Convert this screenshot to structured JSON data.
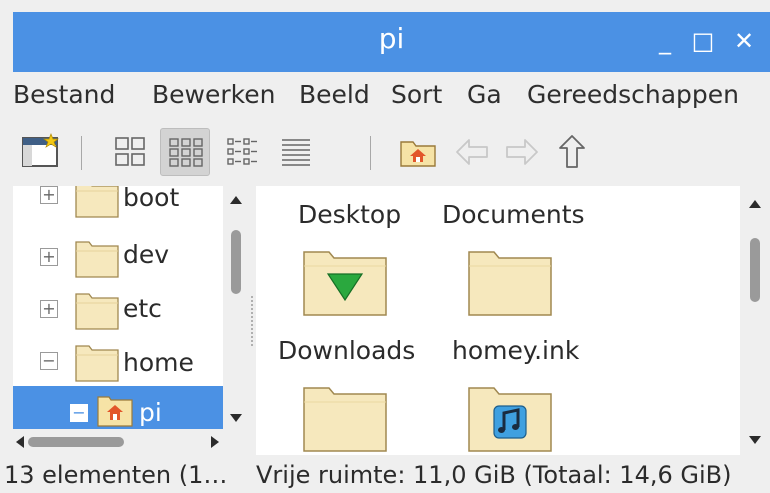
{
  "window": {
    "title": "pi",
    "minimize_glyph": "_",
    "maximize_glyph": "□",
    "close_glyph": "✕",
    "accent_color": "#4b91e4"
  },
  "menubar": {
    "items": [
      "Bestand",
      "Bewerken",
      "Beeld",
      "Sort",
      "Ga",
      "Gereedschappen"
    ]
  },
  "toolbar": {
    "buttons": [
      "new-window-icon",
      "icon-view-icon",
      "thumbnail-view-icon",
      "compact-view-icon",
      "list-view-icon",
      "home-icon",
      "back-arrow-icon",
      "forward-arrow-icon",
      "up-arrow-icon"
    ],
    "active_view": "thumbnail-view-icon"
  },
  "tree": {
    "items": [
      {
        "label": "boot",
        "expander": "+",
        "icon": "folder-icon",
        "selected": false
      },
      {
        "label": "dev",
        "expander": "+",
        "icon": "folder-icon",
        "selected": false
      },
      {
        "label": "etc",
        "expander": "+",
        "icon": "folder-icon",
        "selected": false
      },
      {
        "label": "home",
        "expander": "−",
        "icon": "folder-icon",
        "selected": false
      },
      {
        "label": "pi",
        "expander": "−",
        "icon": "home-folder-icon",
        "selected": true
      }
    ]
  },
  "files": {
    "items": [
      {
        "label": "Desktop",
        "icon": "folder-icon"
      },
      {
        "label": "Documents",
        "icon": "folder-icon"
      },
      {
        "label": "Downloads",
        "icon": "downloads-folder-icon"
      },
      {
        "label": "homey.ink",
        "icon": "folder-icon"
      },
      {
        "label": "",
        "icon": "folder-icon"
      },
      {
        "label": "",
        "icon": "music-folder-icon"
      }
    ]
  },
  "statusbar": {
    "left": "13 elementen (1…",
    "right": "Vrije ruimte: 11,0 GiB (Totaal: 14,6 GiB)"
  }
}
